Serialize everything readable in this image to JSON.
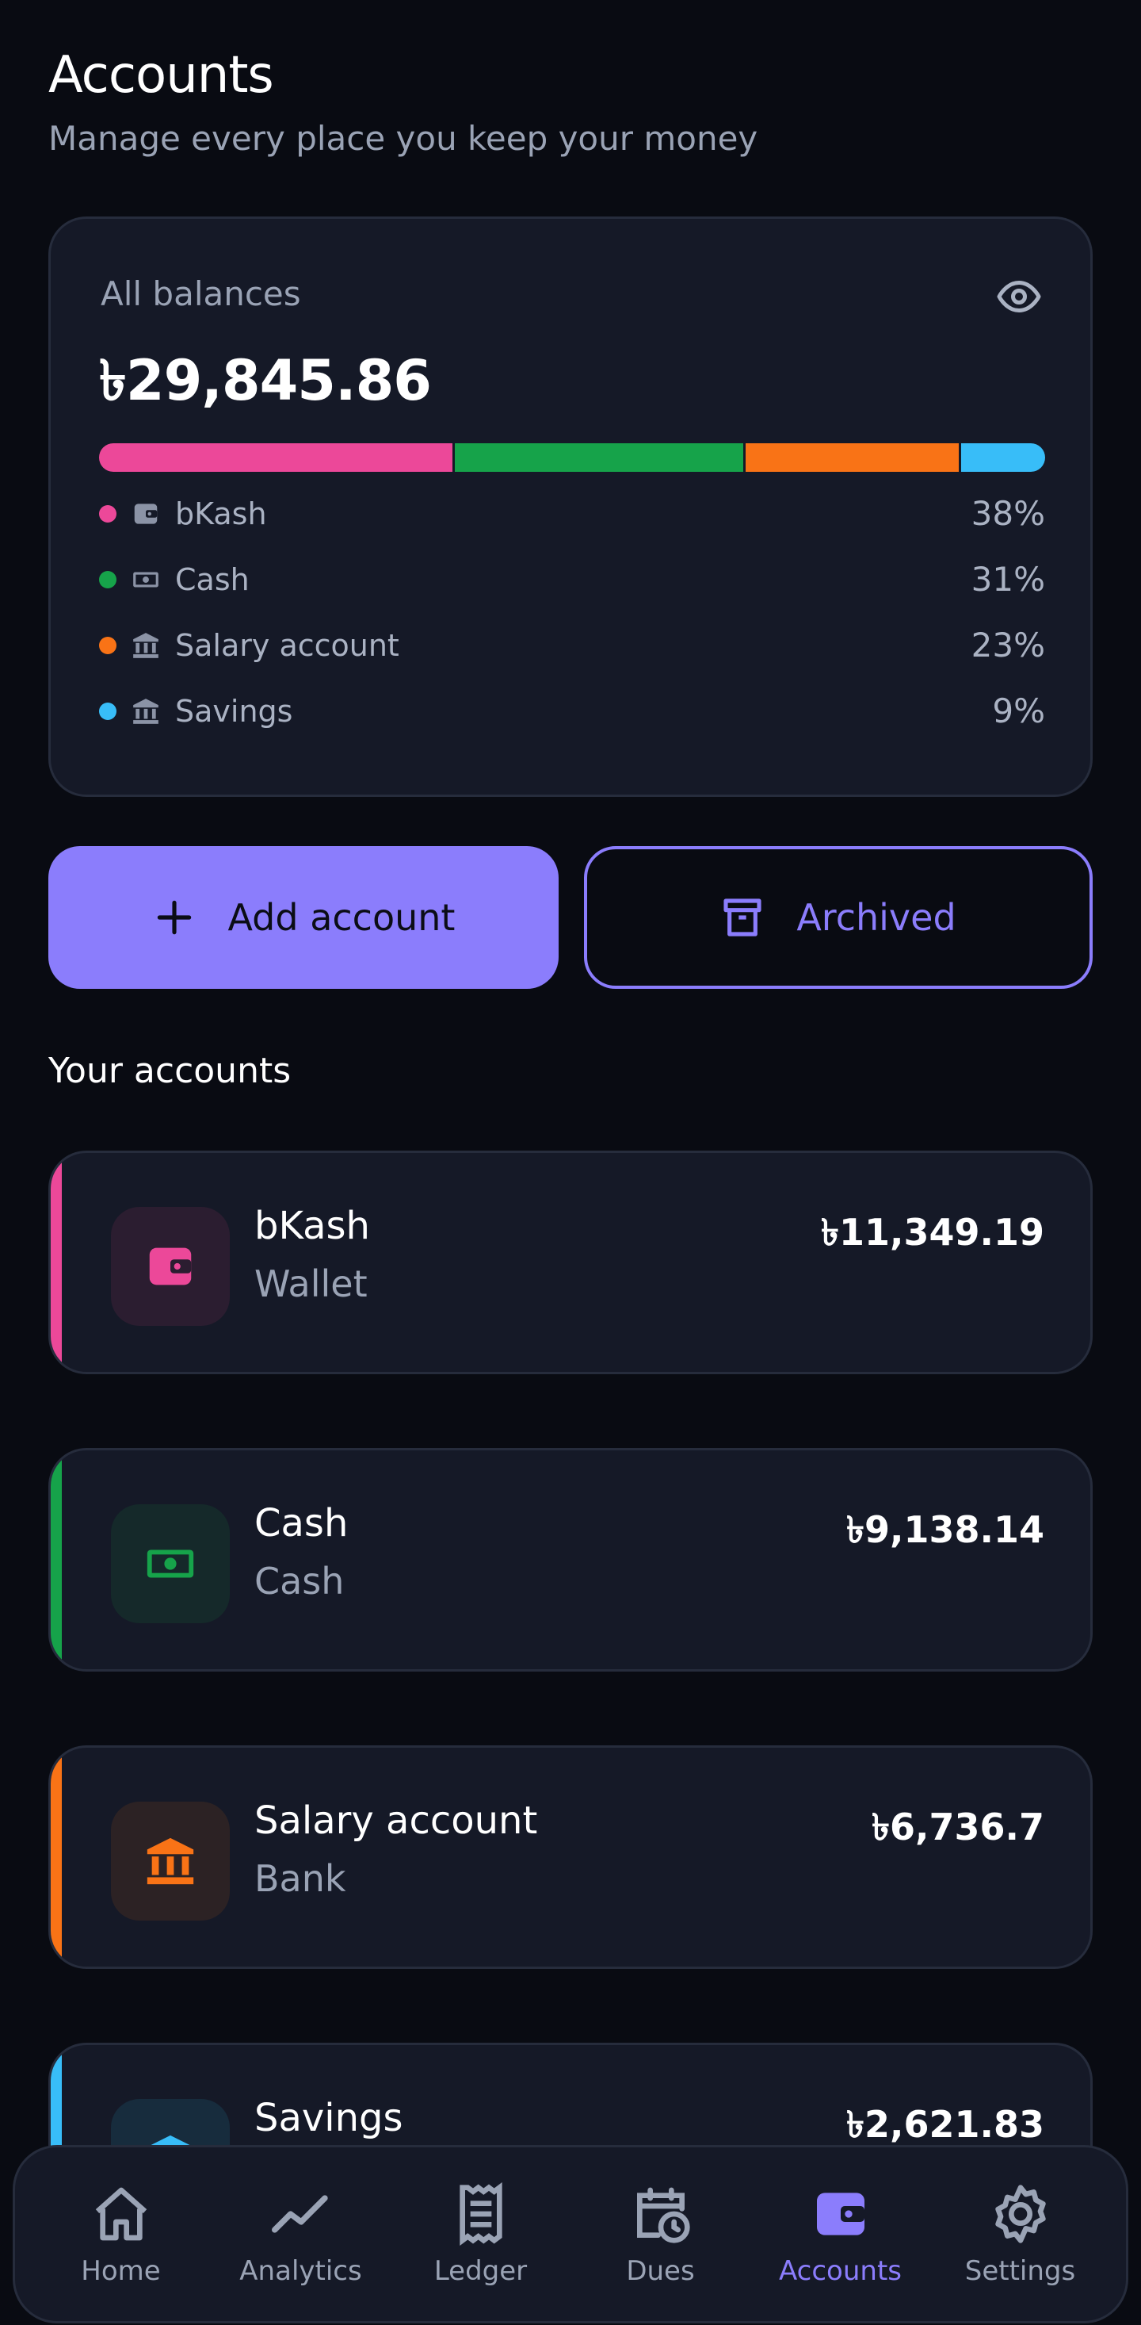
{
  "header": {
    "title": "Accounts",
    "subtitle": "Manage every place you keep your money"
  },
  "summary": {
    "label": "All balances",
    "total": "৳29,845.86",
    "visibility_icon": "eye-icon",
    "breakdown": [
      {
        "name": "bKash",
        "percent": "38%",
        "share": 0.38,
        "color": "#ec4899",
        "icon": "wallet-icon"
      },
      {
        "name": "Cash",
        "percent": "31%",
        "share": 0.31,
        "color": "#16a34a",
        "icon": "cash-icon"
      },
      {
        "name": "Salary account",
        "percent": "23%",
        "share": 0.23,
        "color": "#f97316",
        "icon": "bank-icon"
      },
      {
        "name": "Savings",
        "percent": "9%",
        "share": 0.09,
        "color": "#38bdf8",
        "icon": "bank-icon"
      }
    ]
  },
  "actions": {
    "add_label": "Add account",
    "archived_label": "Archived"
  },
  "section_title": "Your accounts",
  "accounts": [
    {
      "name": "bKash",
      "type": "Wallet",
      "balance": "৳11,349.19",
      "color": "#ec4899",
      "tile_bg": "#2b1d30",
      "icon": "wallet-icon"
    },
    {
      "name": "Cash",
      "type": "Cash",
      "balance": "৳9,138.14",
      "color": "#16a34a",
      "tile_bg": "#15292a",
      "icon": "cash-icon"
    },
    {
      "name": "Salary account",
      "type": "Bank",
      "balance": "৳6,736.7",
      "color": "#f97316",
      "tile_bg": "#2c2224",
      "icon": "bank-icon"
    },
    {
      "name": "Savings",
      "type": "",
      "balance": "৳2,621.83",
      "color": "#38bdf8",
      "tile_bg": "#172c3d",
      "icon": "bank-icon"
    }
  ],
  "nav": {
    "items": [
      {
        "label": "Home",
        "icon": "home-icon"
      },
      {
        "label": "Analytics",
        "icon": "analytics-icon"
      },
      {
        "label": "Ledger",
        "icon": "ledger-icon"
      },
      {
        "label": "Dues",
        "icon": "dues-icon"
      },
      {
        "label": "Accounts",
        "icon": "wallet-icon",
        "active": true
      },
      {
        "label": "Settings",
        "icon": "gear-icon"
      }
    ]
  },
  "colors": {
    "accent": "#8b7dfc",
    "background": "#090b12",
    "card": "#151927"
  }
}
